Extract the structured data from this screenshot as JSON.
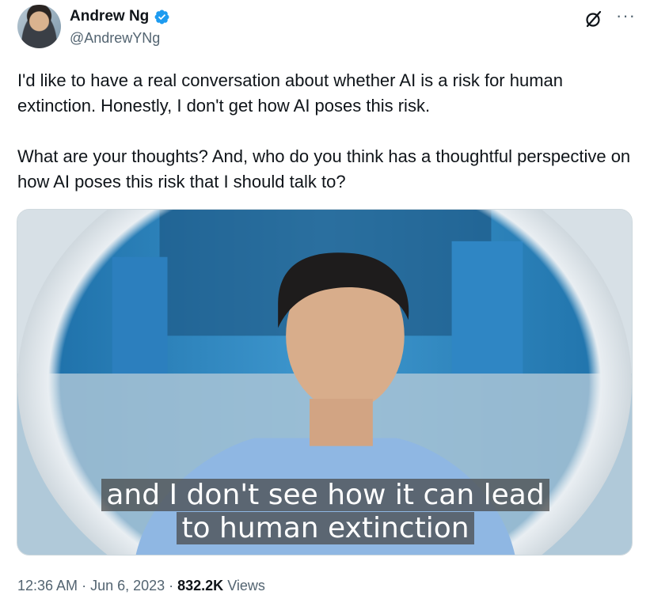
{
  "author": {
    "display_name": "Andrew Ng",
    "handle": "@AndrewYNg",
    "verified": true,
    "avatar_icon": "avatar-photo"
  },
  "header_icons": {
    "grok": "grok-icon",
    "more": "more-icon",
    "more_glyph": "···"
  },
  "tweet": {
    "text": "I'd like to have a real conversation about whether AI is a risk for human extinction. Honestly, I don't get how AI poses this risk.\n\nWhat are your thoughts? And, who do you think has a thoughtful perspective on how AI poses this risk that I should talk to?"
  },
  "media": {
    "type": "video",
    "caption_line1": "and I don't see how it can lead",
    "caption_line2": "to human extinction"
  },
  "meta": {
    "time": "12:36 AM",
    "separator": "·",
    "date": "Jun 6, 2023",
    "views_count": "832.2K",
    "views_label": "Views"
  },
  "colors": {
    "text_primary": "#0f1419",
    "text_secondary": "#536471",
    "verified_blue": "#1d9bf0"
  }
}
